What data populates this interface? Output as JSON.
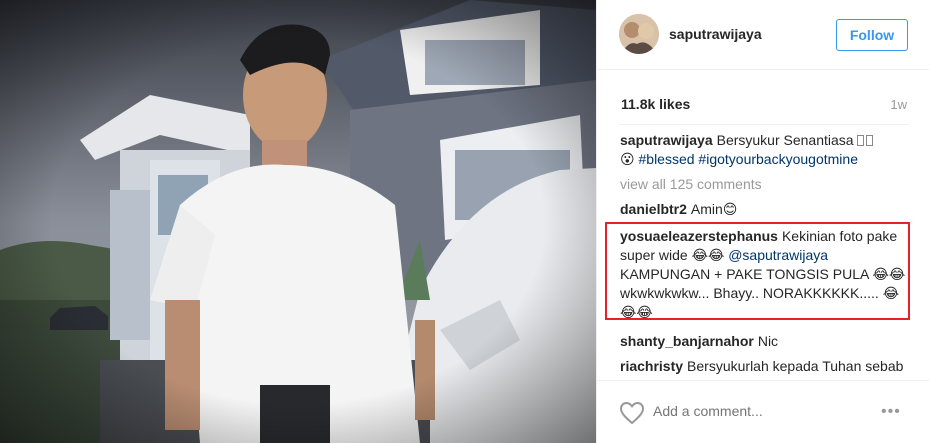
{
  "post": {
    "username": "saputrawijaya",
    "follow_label": "Follow",
    "likes": "11.8k likes",
    "time": "1w",
    "add_comment_placeholder": "Add a comment...",
    "more_label": "•••"
  },
  "caption": {
    "user": "saputrawijaya",
    "text": "Bersyukur Senantiasa",
    "line2_prefix": "😮",
    "hashtags": "#blessed #igotyourbackyougotmine"
  },
  "view_all": "view all 125 comments",
  "comments": [
    {
      "user": "danielbtr2",
      "text": "Amin😊"
    },
    {
      "user": "yosuaeleazerstephanus",
      "text_a": "Kekinian foto pake super wide 😂😂",
      "mention": "@saputrawijaya",
      "text_b": "KAMPUNGAN + PAKE TONGSIS PULA 😂😂wkwkwkwkw... Bhayy.. NORAKKKKKK..... 😂😂😂"
    },
    {
      "user": "shanty_banjarnahor",
      "text": "Nic"
    },
    {
      "user": "riachristy",
      "text": "Bersyukurlah kepada Tuhan sebab dia baik... bahwasannya tuk"
    }
  ],
  "colors": {
    "accent": "#3897f0",
    "highlight": "#e8202a",
    "muted": "#999999"
  }
}
